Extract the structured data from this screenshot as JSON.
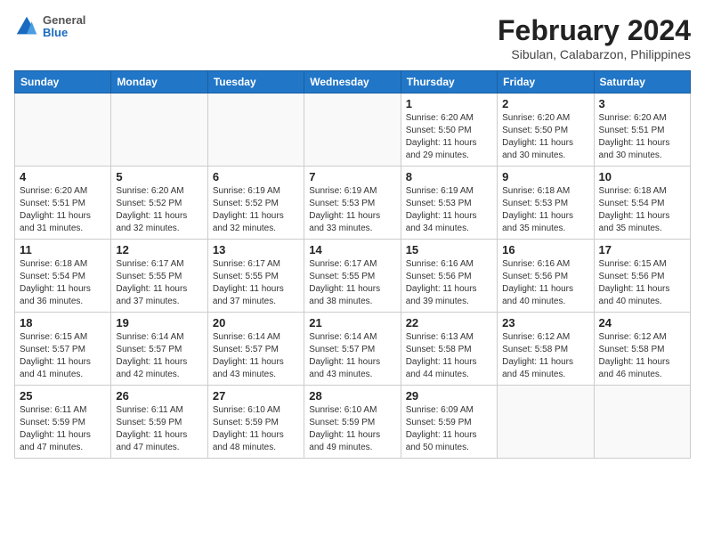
{
  "logo": {
    "general": "General",
    "blue": "Blue"
  },
  "title": "February 2024",
  "subtitle": "Sibulan, Calabarzon, Philippines",
  "headers": [
    "Sunday",
    "Monday",
    "Tuesday",
    "Wednesday",
    "Thursday",
    "Friday",
    "Saturday"
  ],
  "weeks": [
    [
      {
        "day": "",
        "info": ""
      },
      {
        "day": "",
        "info": ""
      },
      {
        "day": "",
        "info": ""
      },
      {
        "day": "",
        "info": ""
      },
      {
        "day": "1",
        "info": "Sunrise: 6:20 AM\nSunset: 5:50 PM\nDaylight: 11 hours and 29 minutes."
      },
      {
        "day": "2",
        "info": "Sunrise: 6:20 AM\nSunset: 5:50 PM\nDaylight: 11 hours and 30 minutes."
      },
      {
        "day": "3",
        "info": "Sunrise: 6:20 AM\nSunset: 5:51 PM\nDaylight: 11 hours and 30 minutes."
      }
    ],
    [
      {
        "day": "4",
        "info": "Sunrise: 6:20 AM\nSunset: 5:51 PM\nDaylight: 11 hours and 31 minutes."
      },
      {
        "day": "5",
        "info": "Sunrise: 6:20 AM\nSunset: 5:52 PM\nDaylight: 11 hours and 32 minutes."
      },
      {
        "day": "6",
        "info": "Sunrise: 6:19 AM\nSunset: 5:52 PM\nDaylight: 11 hours and 32 minutes."
      },
      {
        "day": "7",
        "info": "Sunrise: 6:19 AM\nSunset: 5:53 PM\nDaylight: 11 hours and 33 minutes."
      },
      {
        "day": "8",
        "info": "Sunrise: 6:19 AM\nSunset: 5:53 PM\nDaylight: 11 hours and 34 minutes."
      },
      {
        "day": "9",
        "info": "Sunrise: 6:18 AM\nSunset: 5:53 PM\nDaylight: 11 hours and 35 minutes."
      },
      {
        "day": "10",
        "info": "Sunrise: 6:18 AM\nSunset: 5:54 PM\nDaylight: 11 hours and 35 minutes."
      }
    ],
    [
      {
        "day": "11",
        "info": "Sunrise: 6:18 AM\nSunset: 5:54 PM\nDaylight: 11 hours and 36 minutes."
      },
      {
        "day": "12",
        "info": "Sunrise: 6:17 AM\nSunset: 5:55 PM\nDaylight: 11 hours and 37 minutes."
      },
      {
        "day": "13",
        "info": "Sunrise: 6:17 AM\nSunset: 5:55 PM\nDaylight: 11 hours and 37 minutes."
      },
      {
        "day": "14",
        "info": "Sunrise: 6:17 AM\nSunset: 5:55 PM\nDaylight: 11 hours and 38 minutes."
      },
      {
        "day": "15",
        "info": "Sunrise: 6:16 AM\nSunset: 5:56 PM\nDaylight: 11 hours and 39 minutes."
      },
      {
        "day": "16",
        "info": "Sunrise: 6:16 AM\nSunset: 5:56 PM\nDaylight: 11 hours and 40 minutes."
      },
      {
        "day": "17",
        "info": "Sunrise: 6:15 AM\nSunset: 5:56 PM\nDaylight: 11 hours and 40 minutes."
      }
    ],
    [
      {
        "day": "18",
        "info": "Sunrise: 6:15 AM\nSunset: 5:57 PM\nDaylight: 11 hours and 41 minutes."
      },
      {
        "day": "19",
        "info": "Sunrise: 6:14 AM\nSunset: 5:57 PM\nDaylight: 11 hours and 42 minutes."
      },
      {
        "day": "20",
        "info": "Sunrise: 6:14 AM\nSunset: 5:57 PM\nDaylight: 11 hours and 43 minutes."
      },
      {
        "day": "21",
        "info": "Sunrise: 6:14 AM\nSunset: 5:57 PM\nDaylight: 11 hours and 43 minutes."
      },
      {
        "day": "22",
        "info": "Sunrise: 6:13 AM\nSunset: 5:58 PM\nDaylight: 11 hours and 44 minutes."
      },
      {
        "day": "23",
        "info": "Sunrise: 6:12 AM\nSunset: 5:58 PM\nDaylight: 11 hours and 45 minutes."
      },
      {
        "day": "24",
        "info": "Sunrise: 6:12 AM\nSunset: 5:58 PM\nDaylight: 11 hours and 46 minutes."
      }
    ],
    [
      {
        "day": "25",
        "info": "Sunrise: 6:11 AM\nSunset: 5:59 PM\nDaylight: 11 hours and 47 minutes."
      },
      {
        "day": "26",
        "info": "Sunrise: 6:11 AM\nSunset: 5:59 PM\nDaylight: 11 hours and 47 minutes."
      },
      {
        "day": "27",
        "info": "Sunrise: 6:10 AM\nSunset: 5:59 PM\nDaylight: 11 hours and 48 minutes."
      },
      {
        "day": "28",
        "info": "Sunrise: 6:10 AM\nSunset: 5:59 PM\nDaylight: 11 hours and 49 minutes."
      },
      {
        "day": "29",
        "info": "Sunrise: 6:09 AM\nSunset: 5:59 PM\nDaylight: 11 hours and 50 minutes."
      },
      {
        "day": "",
        "info": ""
      },
      {
        "day": "",
        "info": ""
      }
    ]
  ]
}
